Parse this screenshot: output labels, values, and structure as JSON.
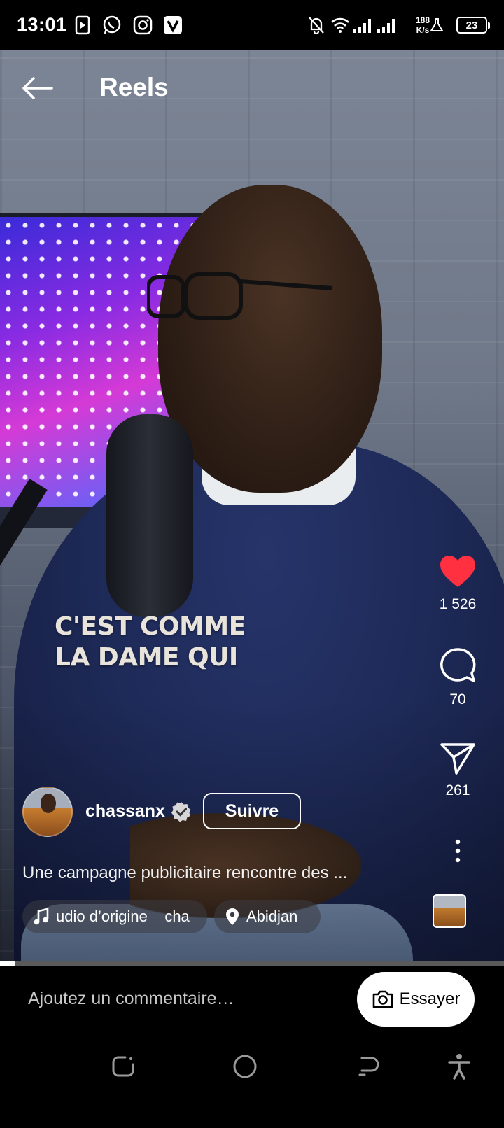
{
  "status_bar": {
    "time": "13:01",
    "net_speed_value": "188",
    "net_speed_unit": "K/s",
    "battery": "23",
    "icons": [
      "media-player-icon",
      "whatsapp-icon",
      "instagram-icon",
      "vivavideo-icon",
      "bell-off-icon",
      "wifi-icon",
      "signal-icon",
      "signal-icon",
      "alert-icon",
      "battery-icon"
    ]
  },
  "header": {
    "title": "Reels",
    "back_icon": "arrow-left-icon"
  },
  "video": {
    "caption_lines": [
      "C'EST COMME",
      "LA DAME QUI"
    ],
    "progress": 0.03
  },
  "actions": {
    "likes": "1 526",
    "comments": "70",
    "shares": "261",
    "like_color": "#ff3040"
  },
  "author": {
    "username": "chassanx",
    "verified": true,
    "follow_label": "Suivre"
  },
  "post": {
    "description": "Une campagne publicitaire rencontre des ...",
    "audio_label": "udio d’origine    cha",
    "location": "Abidjan"
  },
  "comment_bar": {
    "placeholder": "Ajoutez un commentaire…",
    "try_label": "Essayer"
  },
  "navbar": {
    "icons": [
      "recents-icon",
      "home-circle-icon",
      "back-icon",
      "accessibility-icon"
    ]
  }
}
